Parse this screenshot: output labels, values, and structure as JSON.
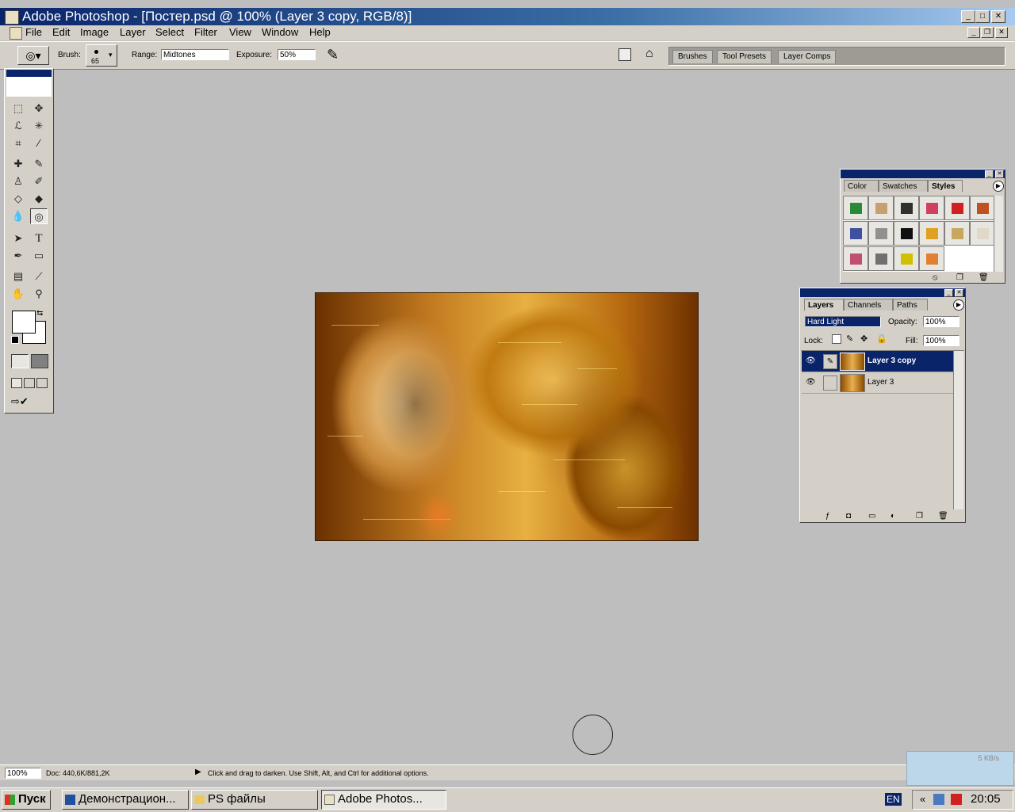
{
  "window": {
    "title": "Adobe Photoshop - [Постер.psd @ 100% (Layer 3 copy, RGB/8)]",
    "min": "_",
    "max": "□",
    "close": "✕"
  },
  "menu": [
    "File",
    "Edit",
    "Image",
    "Layer",
    "Select",
    "Filter",
    "View",
    "Window",
    "Help"
  ],
  "options": {
    "brush_label": "Brush:",
    "brush_size": "65",
    "range_label": "Range:",
    "range_value": "Midtones",
    "exposure_label": "Exposure:",
    "exposure_value": "50%"
  },
  "palette_well": [
    "Brushes",
    "Tool Presets",
    "Layer Comps"
  ],
  "styles_palette": {
    "tabs": [
      "Color",
      "Swatches",
      "Styles"
    ],
    "active_tab": "Styles",
    "swatch_colors": [
      "#2a8a3a",
      "#c8a070",
      "#303030",
      "#d04060",
      "#d02020",
      "#c05020",
      "#4050a0",
      "#909090",
      "#101010",
      "#e0a020",
      "#c8a860",
      "#e0d8c8",
      "#c05070",
      "#707070",
      "#d0c000",
      "#e08030"
    ]
  },
  "layers_palette": {
    "tabs": [
      "Layers",
      "Channels",
      "Paths"
    ],
    "active_tab": "Layers",
    "blend_mode": "Hard Light",
    "opacity_label": "Opacity:",
    "opacity_value": "100%",
    "lock_label": "Lock:",
    "fill_label": "Fill:",
    "fill_value": "100%",
    "layers": [
      {
        "name": "Layer 3 copy",
        "selected": true
      },
      {
        "name": "Layer 3",
        "selected": false
      }
    ]
  },
  "status": {
    "zoom": "100%",
    "doc": "Doc: 440,6K/881,2K",
    "hint": "Click and drag to darken.  Use Shift, Alt, and Ctrl for additional options."
  },
  "network_widget": {
    "speed": "5 KB/s"
  },
  "taskbar": {
    "start": "Пуск",
    "buttons": [
      "Демонстрацион...",
      "PS файлы",
      "Adobe Photos..."
    ],
    "active_index": 2,
    "lang": "EN",
    "clock": "20:05"
  }
}
